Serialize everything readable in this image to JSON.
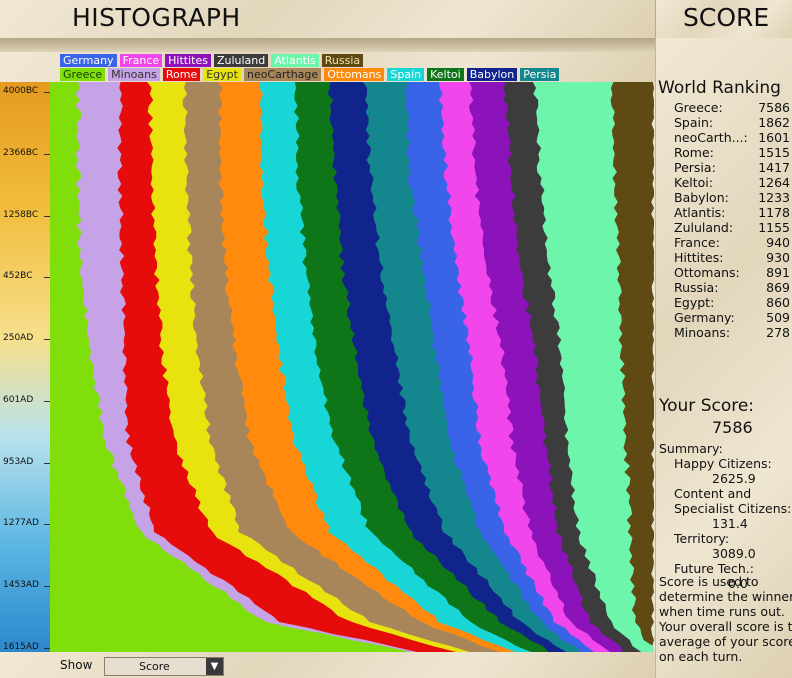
{
  "header": {
    "title": "HISTOGRAPH",
    "score_title": "SCORE"
  },
  "legend": [
    {
      "name": "Germany",
      "color": "#3a64e8",
      "text_color": "#ffffff",
      "row": 0
    },
    {
      "name": "France",
      "color": "#f046ec",
      "text_color": "#ffffff",
      "row": 0
    },
    {
      "name": "Hittites",
      "color": "#8c12ba",
      "text_color": "#ffffff",
      "row": 0
    },
    {
      "name": "Zululand",
      "color": "#3c3c3c",
      "text_color": "#ffffff",
      "row": 0
    },
    {
      "name": "Atlantis",
      "color": "#6ef5ac",
      "text_color": "#ffffff",
      "row": 0
    },
    {
      "name": "Russia",
      "color": "#5e4a12",
      "text_color": "#f2e2a8",
      "row": 0
    },
    {
      "name": "Greece",
      "color": "#80de0a",
      "text_color": "#1a3a00",
      "row": 1
    },
    {
      "name": "Minoans",
      "color": "#c6a2e6",
      "text_color": "#333333",
      "row": 1
    },
    {
      "name": "Rome",
      "color": "#e60c0c",
      "text_color": "#ffffff",
      "row": 1
    },
    {
      "name": "Egypt",
      "color": "#e8e30e",
      "text_color": "#333333",
      "row": 1
    },
    {
      "name": "neoCarthage",
      "color": "#a8865a",
      "text_color": "#222222",
      "row": 1
    },
    {
      "name": "Ottomans",
      "color": "#ff8a0e",
      "text_color": "#ffffff",
      "row": 1
    },
    {
      "name": "Spain",
      "color": "#18d6d6",
      "text_color": "#ffffff",
      "row": 1
    },
    {
      "name": "Keltoi",
      "color": "#0e7618",
      "text_color": "#ffffff",
      "row": 1
    },
    {
      "name": "Babylon",
      "color": "#10248c",
      "text_color": "#ffffff",
      "row": 1
    },
    {
      "name": "Persia",
      "color": "#14868e",
      "text_color": "#ffffff",
      "row": 1
    }
  ],
  "yaxis_ticks": [
    "4000BC",
    "2366BC",
    "1258BC",
    "452BC",
    "250AD",
    "601AD",
    "953AD",
    "1277AD",
    "1453AD",
    "1615AD"
  ],
  "chart_data": {
    "type": "area",
    "series_order": [
      "Greece",
      "Minoans",
      "Rome",
      "Egypt",
      "neoCarthage",
      "Ottomans",
      "Spain",
      "Keltoi",
      "Babylon",
      "Persia",
      "Germany",
      "France",
      "Hittites",
      "Zululand",
      "Atlantis",
      "Russia"
    ],
    "time_ticks": [
      "4000BC",
      "2366BC",
      "1258BC",
      "452BC",
      "250AD",
      "601AD",
      "953AD",
      "1277AD",
      "1453AD",
      "1615AD"
    ]
  },
  "world_ranking": {
    "title": "World Ranking",
    "entries": [
      {
        "name": "Greece:",
        "score": "7586"
      },
      {
        "name": "Spain:",
        "score": "1862"
      },
      {
        "name": "neoCarth...:",
        "score": "1601"
      },
      {
        "name": "Rome:",
        "score": "1515"
      },
      {
        "name": "Persia:",
        "score": "1417"
      },
      {
        "name": "Keltoi:",
        "score": "1264"
      },
      {
        "name": "Babylon:",
        "score": "1233"
      },
      {
        "name": "Atlantis:",
        "score": "1178"
      },
      {
        "name": "Zululand:",
        "score": "1155"
      },
      {
        "name": "France:",
        "score": "940"
      },
      {
        "name": "Hittites:",
        "score": "930"
      },
      {
        "name": "Ottomans:",
        "score": "891"
      },
      {
        "name": "Russia:",
        "score": "869"
      },
      {
        "name": "Egypt:",
        "score": "860"
      },
      {
        "name": "Germany:",
        "score": "509"
      },
      {
        "name": "Minoans:",
        "score": "278"
      }
    ]
  },
  "your_score": {
    "title": "Your Score:",
    "value": "7586",
    "summary_label": "Summary:",
    "happy_label": "Happy Citizens:",
    "happy_value": "2625.9",
    "content_label_1": "Content and",
    "content_label_2": "Specialist Citizens:",
    "content_value": "131.4",
    "territory_label": "Territory:",
    "territory_value": "3089.0",
    "future_label": "Future Tech.:",
    "future_value": "0.0",
    "note_lines": [
      "Score is used to",
      "determine the winner",
      "when time runs out.",
      "Your overall score is th",
      "average of your scores",
      "on each turn."
    ]
  },
  "footer": {
    "show_label": "Show",
    "show_value": "Score"
  }
}
